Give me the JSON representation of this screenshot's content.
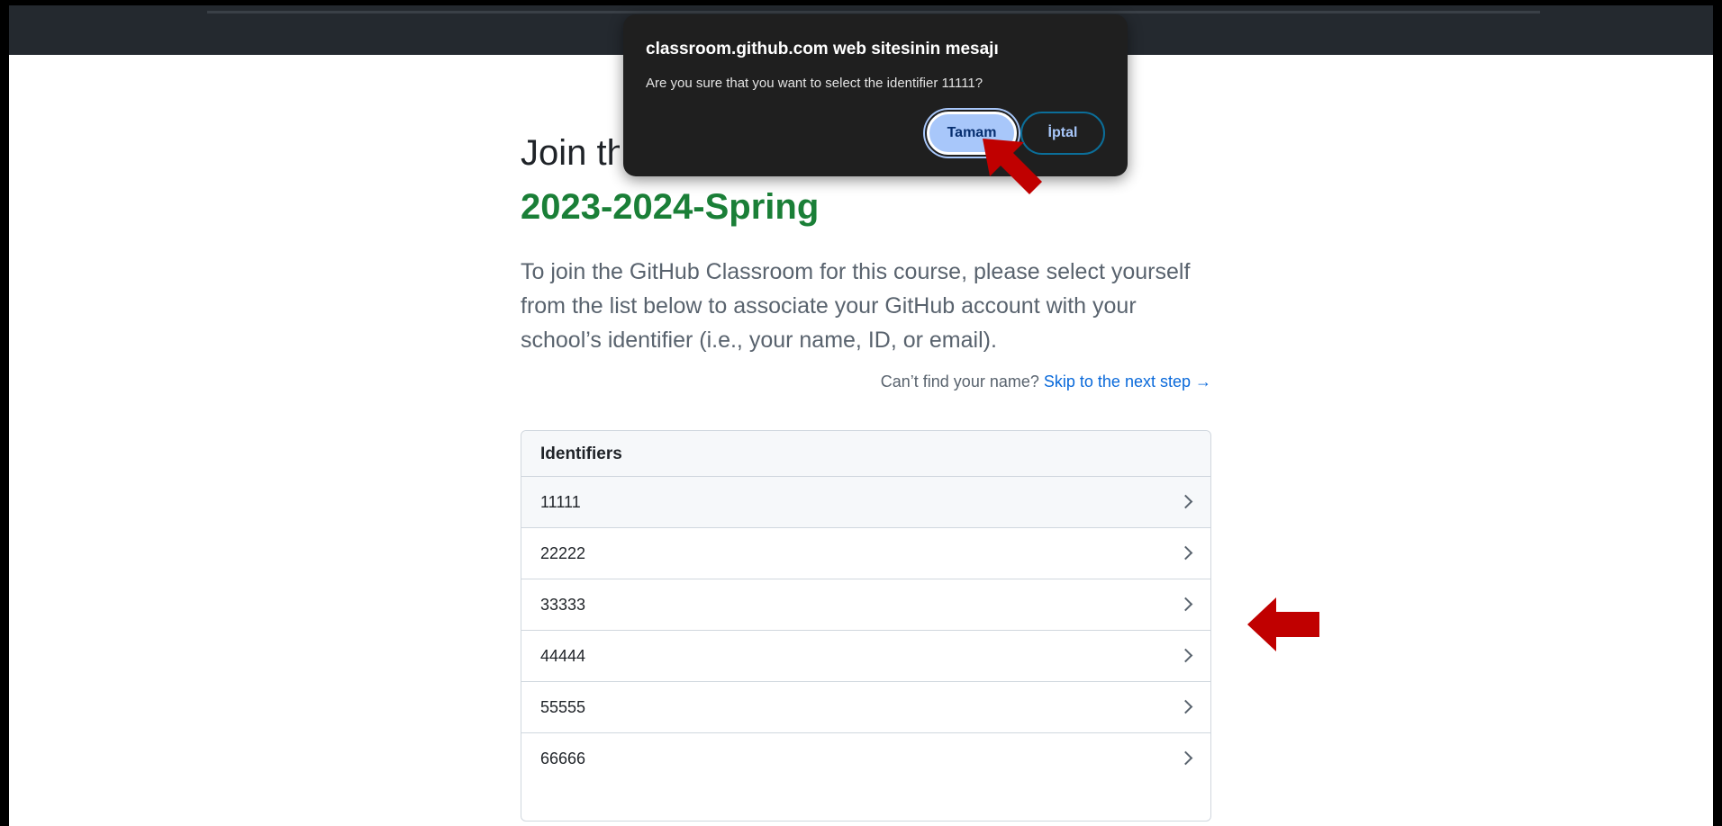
{
  "page": {
    "join_title": "Join the",
    "classroom_name": "2023-2024-Spring",
    "intro": "To join the GitHub Classroom for this course, please select yourself from the list below to associate your GitHub account with your school’s identifier (i.e., your name, ID, or email).",
    "cant_find": "Can’t find your name?",
    "skip_link": "Skip to the next step →"
  },
  "identifiers": {
    "header": "Identifiers",
    "rows": [
      "11111",
      "22222",
      "33333",
      "44444",
      "55555",
      "66666"
    ]
  },
  "dialog": {
    "title": "classroom.github.com web sitesinin mesajı",
    "message": "Are you sure that you want to select the identifier 11111?",
    "ok_label": "Tamam",
    "cancel_label": "İptal"
  },
  "colors": {
    "topbar": "#24292f",
    "classroom_name": "#1a7f37",
    "link": "#0969da",
    "dialog_bg": "#1f1f1f",
    "ok_button": "#a8c7fa",
    "annotation_arrow": "#c00000"
  },
  "icons": {
    "row_chevron": "chevron-right-icon",
    "annotation": "red-arrow-icon"
  }
}
